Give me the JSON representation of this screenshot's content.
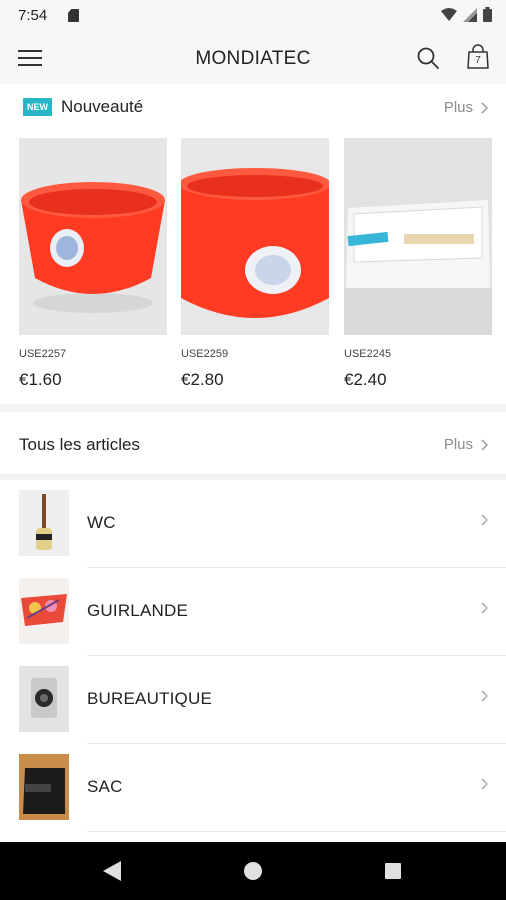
{
  "status_bar": {
    "time": "7:54",
    "icons": [
      "sd-card-icon",
      "wifi-icon",
      "signal-icon",
      "battery-icon"
    ]
  },
  "app_bar": {
    "title": "MONDIATEC",
    "cart_count": "7",
    "icons": [
      "menu-icon",
      "search-icon",
      "shopping-bag-icon"
    ]
  },
  "new_section": {
    "badge": "NEW",
    "title": "Nouveauté",
    "more_label": "Plus",
    "products": [
      {
        "code": "USE2257",
        "price": "€1.60"
      },
      {
        "code": "USE2259",
        "price": "€2.80"
      },
      {
        "code": "USE2245",
        "price": "€2.40"
      }
    ]
  },
  "all_section": {
    "title": "Tous les articles",
    "more_label": "Plus",
    "categories": [
      {
        "label": "WC"
      },
      {
        "label": "GUIRLANDE"
      },
      {
        "label": "BUREAUTIQUE"
      },
      {
        "label": "SAC"
      }
    ]
  },
  "colors": {
    "accent_badge": "#27b6c6",
    "product_red": "#ff3b24",
    "muted_text": "#8c8c8c"
  }
}
